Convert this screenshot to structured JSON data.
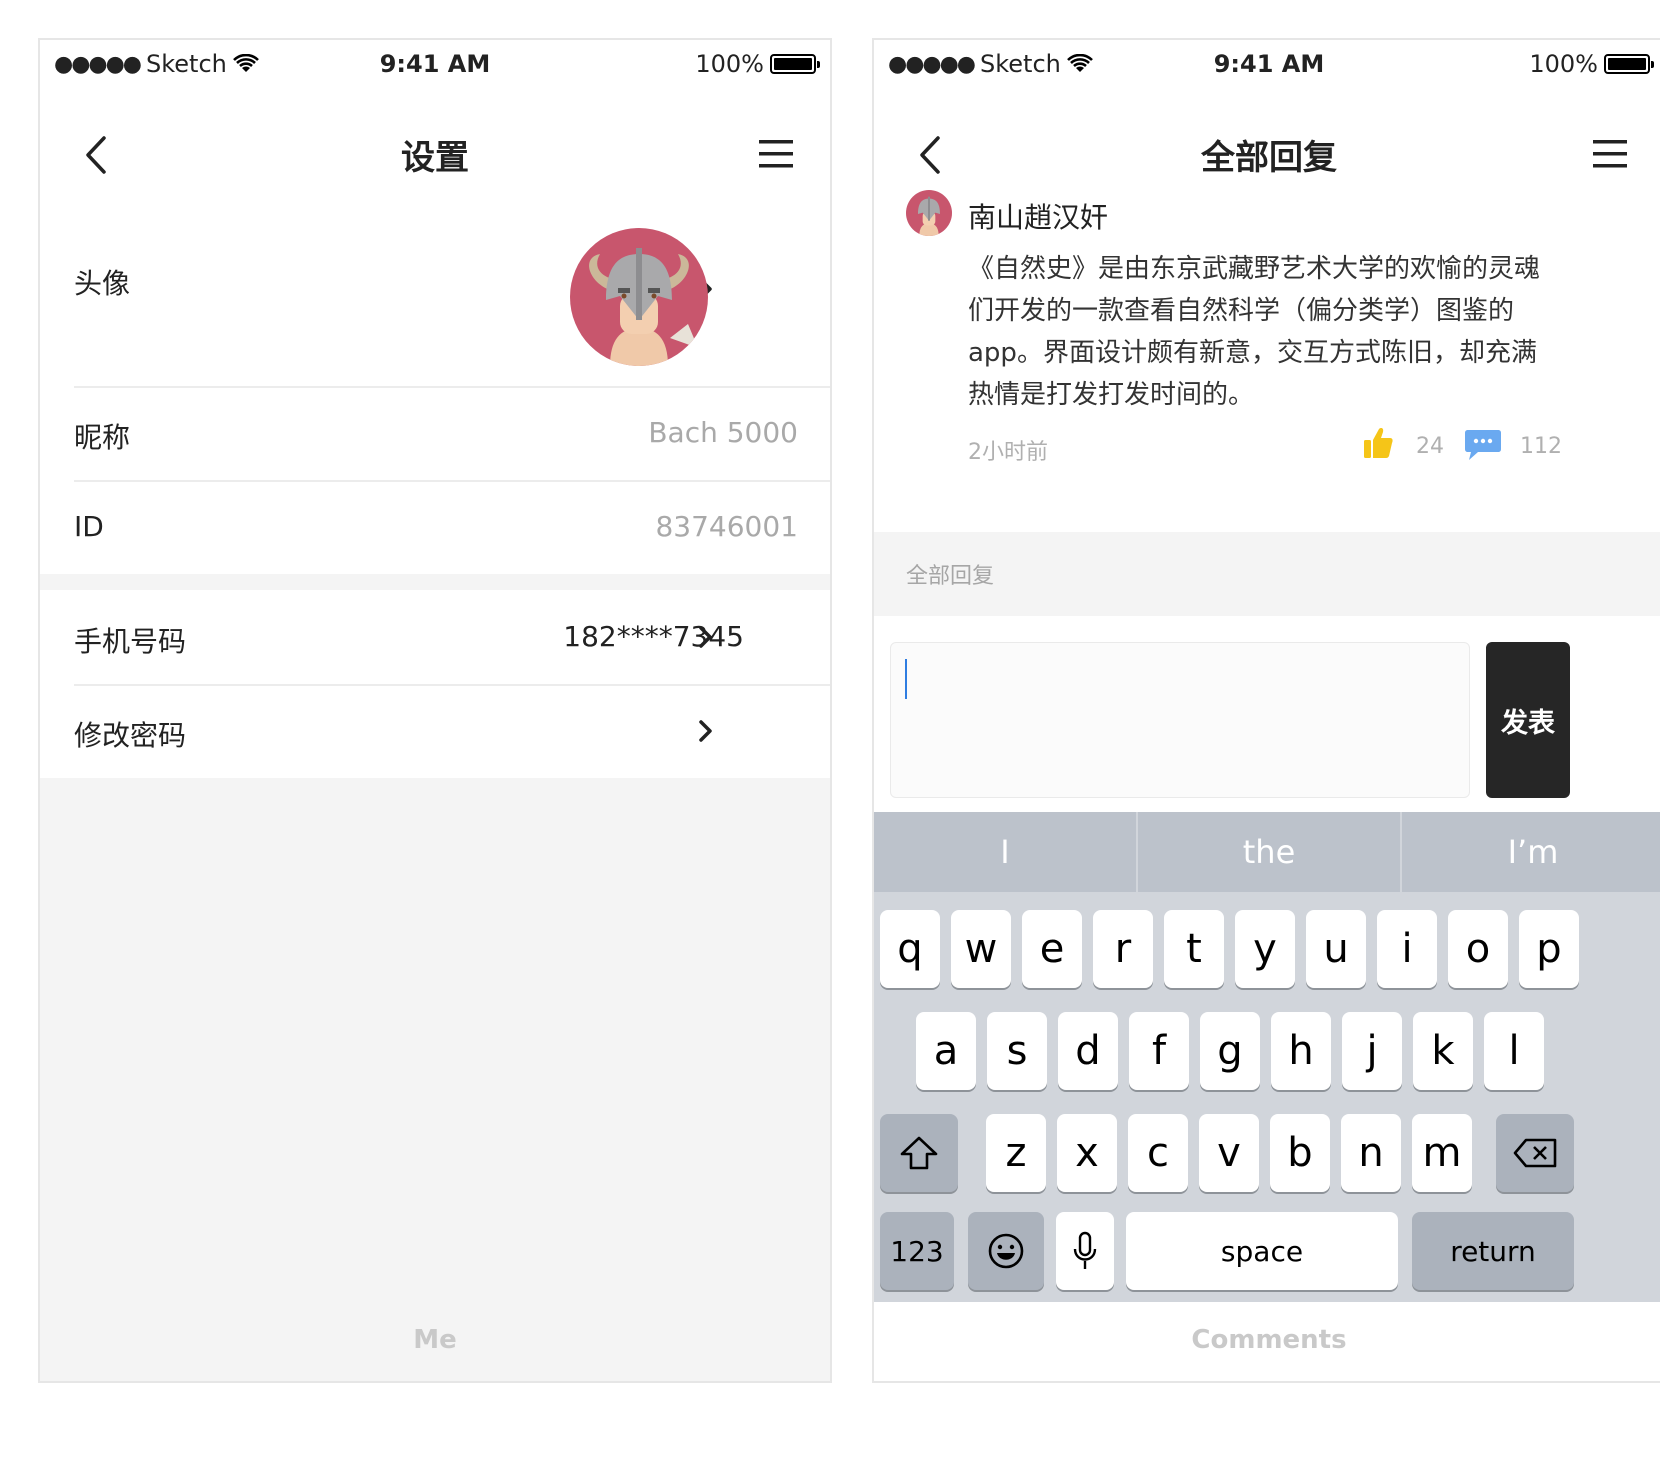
{
  "status_bar": {
    "signal_dots": "●●●●●",
    "carrier": "Sketch",
    "time": "9:41 AM",
    "battery": "100%"
  },
  "me": {
    "title": "设置",
    "avatar_label": "头像",
    "nickname_label": "昵称",
    "nickname_value": "Bach 5000",
    "id_label": "ID",
    "id_value": "83746001",
    "phone_label": "手机号码",
    "phone_value": "182****7345",
    "password_label": "修改密码",
    "caption": "Me"
  },
  "comments": {
    "title": "全部回复",
    "comment": {
      "author": "南山趙汉奸",
      "text": "《自然史》是由东京武藏野艺术大学的欢愉的灵魂们开发的一款查看自然科学（偏分类学）图鉴的app。界面设计颇有新意，交互方式陈旧，却充满热情是打发打发时间的。",
      "time": "2小时前",
      "likes": "24",
      "replies": "112"
    },
    "section_label": "全部回复",
    "input_value": "",
    "send_label": "发表",
    "caption": "Comments"
  },
  "keyboard": {
    "suggestions": [
      "I",
      "the",
      "I’m"
    ],
    "row1": [
      "q",
      "w",
      "e",
      "r",
      "t",
      "y",
      "u",
      "i",
      "o",
      "p"
    ],
    "row2": [
      "a",
      "s",
      "d",
      "f",
      "g",
      "h",
      "j",
      "k",
      "l"
    ],
    "row3": [
      "z",
      "x",
      "c",
      "v",
      "b",
      "n",
      "m"
    ],
    "numbers_label": "123",
    "space_label": "space",
    "return_label": "return"
  },
  "colors": {
    "accent_dark": "#262626",
    "like_yellow": "#f5c518",
    "comment_blue": "#6aa9f0",
    "avatar_bg": "#c8566d"
  }
}
